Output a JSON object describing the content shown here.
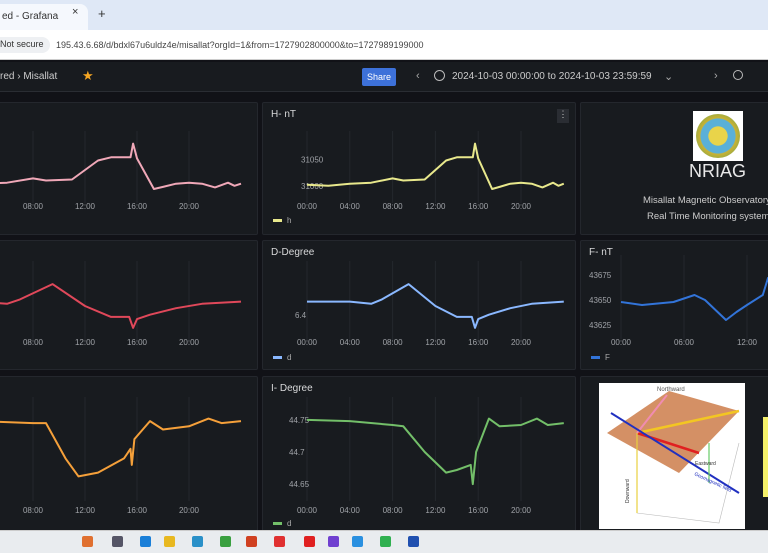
{
  "browser": {
    "tab_title": "ed - Grafana",
    "close": "×",
    "new_tab": "+",
    "security": "Not secure",
    "url": "195.43.6.68/d/bdxl67u6uldz4e/misallat?orgId=1&from=1727902800000&to=1727989199000"
  },
  "grafana": {
    "breadcrumb": "red  ›  Misallat",
    "star": "★",
    "share": "Share",
    "prev": "‹",
    "next": "›",
    "time_range": "2024-10-03 00:00:00 to 2024-10-03 23:59:59",
    "caret": "⌄"
  },
  "panels": {
    "x": {
      "color": "#f0a8b8",
      "ticks": [
        "00",
        "08:00",
        "12:00",
        "16:00",
        "20:00"
      ],
      "points": [
        [
          0,
          31002
        ],
        [
          2,
          31000
        ],
        [
          4,
          31004
        ],
        [
          6,
          31006
        ],
        [
          8,
          31014
        ],
        [
          9,
          31010
        ],
        [
          11,
          31012
        ],
        [
          13,
          31048
        ],
        [
          14,
          31054
        ],
        [
          15.5,
          31054
        ],
        [
          15.7,
          31080
        ],
        [
          16,
          31052
        ],
        [
          17.3,
          30994
        ],
        [
          18,
          30998
        ],
        [
          19,
          31004
        ],
        [
          20,
          31006
        ],
        [
          21,
          31004
        ],
        [
          22,
          30997
        ],
        [
          23,
          31006
        ],
        [
          23.5,
          31000
        ],
        [
          24,
          31004
        ]
      ]
    },
    "h": {
      "title": "H- nT",
      "legend": "h",
      "color": "#e8e88c",
      "yticks": [
        "31050",
        "31000"
      ],
      "ticks": [
        "00:00",
        "04:00",
        "08:00",
        "12:00",
        "16:00",
        "20:00"
      ],
      "points": [
        [
          0,
          31002
        ],
        [
          2,
          31000
        ],
        [
          4,
          31004
        ],
        [
          6,
          31006
        ],
        [
          8,
          31014
        ],
        [
          9,
          31010
        ],
        [
          11,
          31012
        ],
        [
          13,
          31048
        ],
        [
          14,
          31054
        ],
        [
          15.5,
          31054
        ],
        [
          15.7,
          31080
        ],
        [
          16,
          31052
        ],
        [
          17.3,
          30994
        ],
        [
          18,
          30998
        ],
        [
          19,
          31004
        ],
        [
          20,
          31006
        ],
        [
          21,
          31004
        ],
        [
          22,
          30997
        ],
        [
          23,
          31006
        ],
        [
          23.5,
          31000
        ],
        [
          24,
          31004
        ]
      ]
    },
    "y": {
      "color": "#e0485a",
      "ticks": [
        "00",
        "08:00",
        "12:00",
        "16:00",
        "20:00"
      ],
      "points": [
        [
          0,
          6.43
        ],
        [
          4,
          6.43
        ],
        [
          6,
          6.425
        ],
        [
          7,
          6.435
        ],
        [
          9.5,
          6.47
        ],
        [
          12,
          6.42
        ],
        [
          14,
          6.395
        ],
        [
          15.4,
          6.395
        ],
        [
          15.7,
          6.37
        ],
        [
          16,
          6.39
        ],
        [
          17,
          6.4
        ],
        [
          19,
          6.415
        ],
        [
          21,
          6.425
        ],
        [
          24,
          6.43
        ]
      ]
    },
    "d": {
      "title": "D-Degree",
      "legend": "d",
      "color": "#8ab8ff",
      "yticks": [
        "6.4"
      ],
      "ticks": [
        "00:00",
        "04:00",
        "08:00",
        "12:00",
        "16:00",
        "20:00"
      ],
      "points": [
        [
          0,
          6.43
        ],
        [
          4,
          6.43
        ],
        [
          6,
          6.425
        ],
        [
          7,
          6.435
        ],
        [
          9.5,
          6.47
        ],
        [
          12,
          6.42
        ],
        [
          14,
          6.395
        ],
        [
          15.4,
          6.395
        ],
        [
          15.7,
          6.37
        ],
        [
          16,
          6.39
        ],
        [
          17,
          6.4
        ],
        [
          19,
          6.415
        ],
        [
          21,
          6.425
        ],
        [
          24,
          6.43
        ]
      ]
    },
    "f": {
      "title": "F- nT",
      "legend": "F",
      "color": "#3274d9",
      "yticks": [
        "43675",
        "43650",
        "43625"
      ],
      "ticks": [
        "00:00",
        "06:00",
        "12:00"
      ],
      "points": [
        [
          0,
          43648
        ],
        [
          2,
          43645
        ],
        [
          5,
          43648
        ],
        [
          7,
          43655
        ],
        [
          8,
          43650
        ],
        [
          10,
          43630
        ],
        [
          11,
          43638
        ],
        [
          12,
          43645
        ],
        [
          13.5,
          43655
        ],
        [
          14,
          43672
        ],
        [
          14.3,
          43658
        ],
        [
          15,
          43662
        ]
      ]
    },
    "z": {
      "color": "#f5a03a",
      "ticks": [
        "00",
        "08:00",
        "12:00",
        "16:00",
        "20:00"
      ],
      "points": [
        [
          0,
          44.75
        ],
        [
          4,
          44.748
        ],
        [
          8,
          44.745
        ],
        [
          9,
          44.745
        ],
        [
          10.5,
          44.69
        ],
        [
          11.5,
          44.662
        ],
        [
          13,
          44.668
        ],
        [
          15,
          44.69
        ],
        [
          15.5,
          44.705
        ],
        [
          15.6,
          44.68
        ],
        [
          15.8,
          44.72
        ],
        [
          17,
          44.748
        ],
        [
          18,
          44.735
        ],
        [
          20,
          44.74
        ],
        [
          21.5,
          44.752
        ],
        [
          22.5,
          44.745
        ],
        [
          24,
          44.748
        ]
      ]
    },
    "i": {
      "title": "I- Degree",
      "legend": "d",
      "color": "#73bf69",
      "yticks": [
        "44.75",
        "44.7",
        "44.65"
      ],
      "ticks": [
        "00:00",
        "04:00",
        "08:00",
        "12:00",
        "16:00",
        "20:00"
      ],
      "points": [
        [
          0,
          44.75
        ],
        [
          4,
          44.748
        ],
        [
          8,
          44.742
        ],
        [
          9,
          44.74
        ],
        [
          11,
          44.7
        ],
        [
          13,
          44.668
        ],
        [
          14,
          44.672
        ],
        [
          15.3,
          44.68
        ],
        [
          15.5,
          44.65
        ],
        [
          15.8,
          44.7
        ],
        [
          17,
          44.752
        ],
        [
          18,
          44.74
        ],
        [
          20,
          44.742
        ],
        [
          21.5,
          44.752
        ],
        [
          22.5,
          44.742
        ],
        [
          24,
          44.745
        ]
      ]
    }
  },
  "info": {
    "logo_text": "NRIAG",
    "line1": "Misallat Magnetic Observatory",
    "line2": "Real Time Monitoring system"
  },
  "diagram": {
    "labels": [
      "Northward",
      "Eastward",
      "Downward",
      "Geomagnetic field",
      "X",
      "Y",
      "Z",
      "H",
      "D",
      "I",
      "F"
    ]
  }
}
